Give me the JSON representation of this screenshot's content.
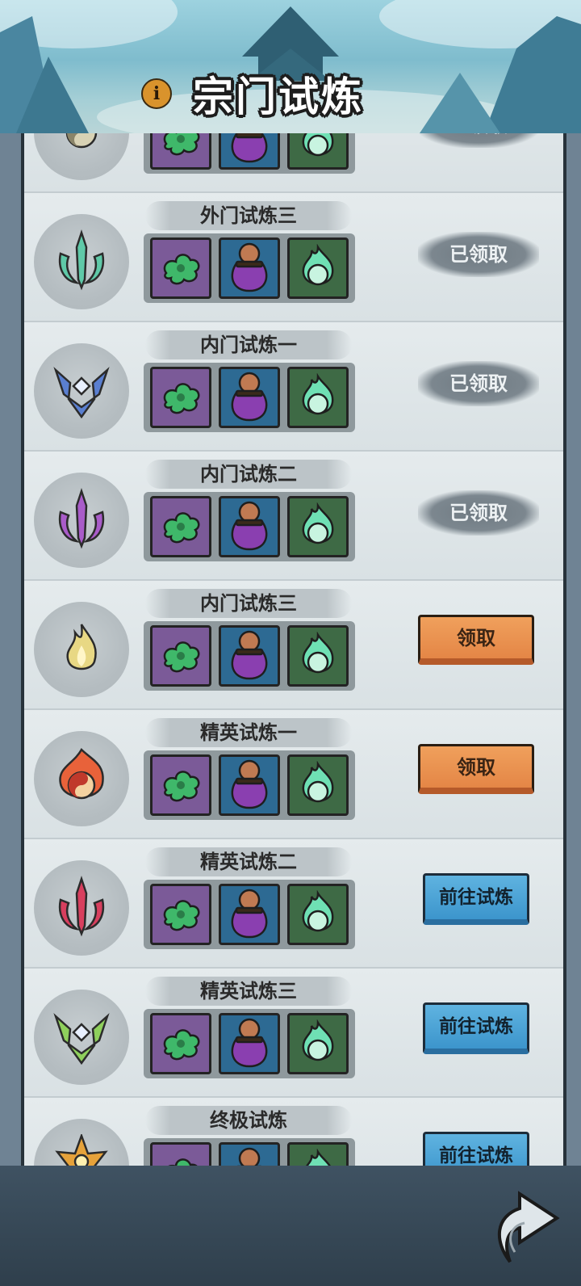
{
  "header": {
    "title": "宗门试炼",
    "info_icon": "info-icon",
    "info_glyph": "i"
  },
  "trials": [
    {
      "name": "",
      "emblem": "taiji-emblem-icon",
      "emblem_color": "#b8b08a",
      "status": "已领取",
      "status_type": "claimed"
    },
    {
      "name": "外门试炼三",
      "emblem": "sword-emblem-icon",
      "emblem_color": "#5fc9a8",
      "status": "已领取",
      "status_type": "claimed"
    },
    {
      "name": "内门试炼一",
      "emblem": "helmet-emblem-icon",
      "emblem_color": "#5a7fd0",
      "status": "已领取",
      "status_type": "claimed"
    },
    {
      "name": "内门试炼二",
      "emblem": "dagger-emblem-icon",
      "emblem_color": "#a95cc9",
      "status": "已领取",
      "status_type": "claimed"
    },
    {
      "name": "内门试炼三",
      "emblem": "flame-emblem-icon",
      "emblem_color": "#e8d884",
      "status": "领取",
      "status_type": "claim"
    },
    {
      "name": "精英试炼一",
      "emblem": "fire-taiji-emblem-icon",
      "emblem_color": "#e8623a",
      "status": "领取",
      "status_type": "claim"
    },
    {
      "name": "精英试炼二",
      "emblem": "red-sword-emblem-icon",
      "emblem_color": "#d83f5e",
      "status": "前往试炼",
      "status_type": "go"
    },
    {
      "name": "精英试炼三",
      "emblem": "green-helmet-emblem-icon",
      "emblem_color": "#8fd05c",
      "status": "前往试炼",
      "status_type": "go"
    },
    {
      "name": "终极试炼",
      "emblem": "golden-emblem-icon",
      "emblem_color": "#e6a23a",
      "status": "前往试炼",
      "status_type": "go"
    }
  ],
  "rewards": [
    {
      "icon": "jade-cloud-icon",
      "slot": "purple"
    },
    {
      "icon": "treasure-pouch-icon",
      "slot": "blue"
    },
    {
      "icon": "spirit-flame-orb-icon",
      "slot": "green"
    }
  ],
  "footer": {
    "back_icon": "return-arrow-icon"
  }
}
